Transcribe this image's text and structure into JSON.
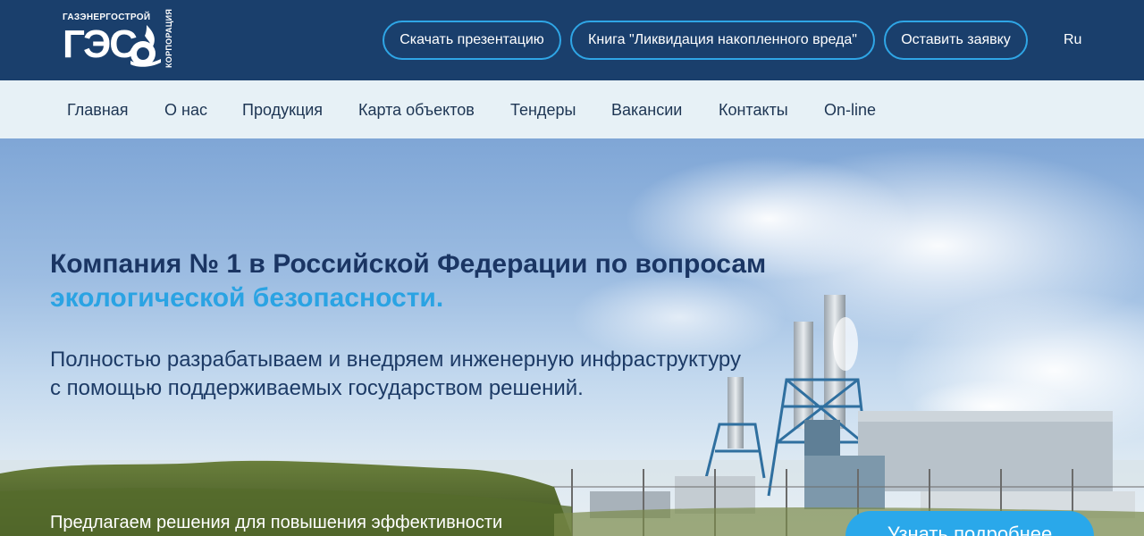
{
  "header": {
    "logo": {
      "top_text": "ГАЗЭНЕРГОСТРОЙ",
      "main_text": "ГЭС",
      "side_text": "КОРПОРАЦИЯ"
    },
    "buttons": [
      {
        "label": "Скачать презентацию"
      },
      {
        "label": "Книга \"Ликвидация накопленного вреда\""
      },
      {
        "label": "Оставить заявку"
      }
    ],
    "language": "Ru"
  },
  "nav": {
    "items": [
      {
        "label": "Главная"
      },
      {
        "label": "О нас"
      },
      {
        "label": "Продукция"
      },
      {
        "label": "Карта объектов"
      },
      {
        "label": "Тендеры"
      },
      {
        "label": "Вакансии"
      },
      {
        "label": "Контакты"
      },
      {
        "label": "On-line"
      }
    ]
  },
  "hero": {
    "title_main": "Компания № 1 в Российской Федерации по вопросам",
    "title_accent": "экологической безопасности.",
    "subtitle_line1": "Полностью разрабатываем и внедряем инженерную инфраструктуру",
    "subtitle_line2": "с помощью поддерживаемых государством решений.",
    "bottom_text": "Предлагаем решения для повышения эффективности",
    "cta_label": "Узнать подробнее"
  },
  "colors": {
    "header_bg": "#1a3f6c",
    "nav_bg": "#e7f1f6",
    "accent": "#2aa3e3",
    "title": "#1a3563"
  }
}
